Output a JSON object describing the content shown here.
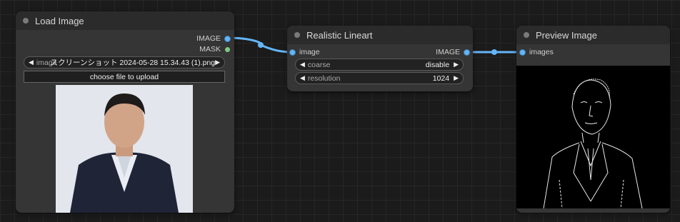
{
  "load_image": {
    "title": "Load Image",
    "outputs": [
      "IMAGE",
      "MASK"
    ],
    "image_widget": {
      "label": "image",
      "value": "スクリーンショット 2024-05-28 15.34.43 (1).png"
    },
    "upload_button": "choose file to upload"
  },
  "lineart": {
    "title": "Realistic Lineart",
    "input": "image",
    "output": "IMAGE",
    "widgets": [
      {
        "label": "coarse",
        "value": "disable"
      },
      {
        "label": "resolution",
        "value": "1024"
      }
    ]
  },
  "preview": {
    "title": "Preview Image",
    "input": "images"
  },
  "colors": {
    "canvas": "#1b1b1b",
    "node": "#353535",
    "link": "#64b5f6",
    "mask_slot": "#81c784"
  }
}
